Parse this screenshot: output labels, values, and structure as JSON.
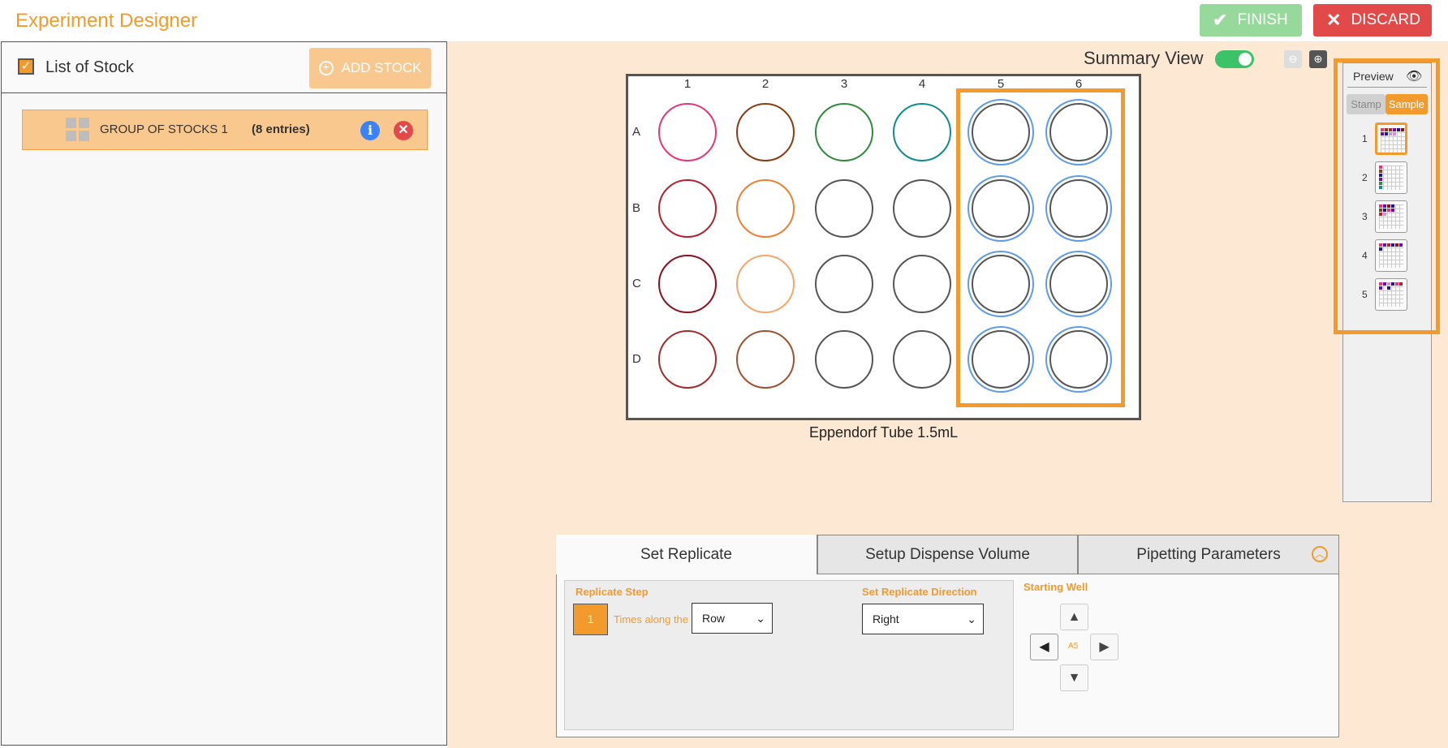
{
  "app": {
    "title": "Experiment Designer",
    "finish_label": "FINISH",
    "discard_label": "DISCARD",
    "accent_color": "#f39a2c"
  },
  "stock_panel": {
    "title": "List of Stock",
    "checked": true,
    "add_label": "ADD STOCK",
    "items": [
      {
        "name": "GROUP OF STOCKS 1",
        "count": "(8 entries)"
      }
    ]
  },
  "view": {
    "summary_label": "Summary View",
    "summary_on": true
  },
  "plate": {
    "name": "Eppendorf Tube 1.5mL",
    "columns": [
      "1",
      "2",
      "3",
      "4",
      "5",
      "6"
    ],
    "rows": [
      "A",
      "B",
      "C",
      "D"
    ],
    "well_colors": [
      [
        "#e8347a",
        "#8a3b12",
        "#2e8b3c",
        "#0f8c8c",
        "#555555",
        "#555555"
      ],
      [
        "#b2232e",
        "#f08030",
        "#555555",
        "#555555",
        "#555555",
        "#555555"
      ],
      [
        "#8b1020",
        "#f6a56b",
        "#555555",
        "#555555",
        "#555555",
        "#555555"
      ],
      [
        "#a52a2a",
        "#a0522d",
        "#555555",
        "#555555",
        "#555555",
        "#555555"
      ]
    ],
    "selected_columns": [
      "5",
      "6"
    ]
  },
  "preview": {
    "title": "Preview",
    "tabs": [
      "Stamp",
      "Sample"
    ],
    "active_tab": "Sample",
    "items": [
      "1",
      "2",
      "3",
      "4",
      "5"
    ],
    "active_item": "1"
  },
  "settings": {
    "tabs": [
      "Set Replicate",
      "Setup Dispense Volume",
      "Pipetting Parameters"
    ],
    "active_tab": "Set Replicate",
    "replicate_step_label": "Replicate Step",
    "step_value": "1",
    "times_label": "Times along the",
    "along_value": "Row",
    "direction_label": "Set Replicate Direction",
    "direction_value": "Right",
    "starting_well_label": "Starting Well",
    "starting_well": "A5"
  }
}
